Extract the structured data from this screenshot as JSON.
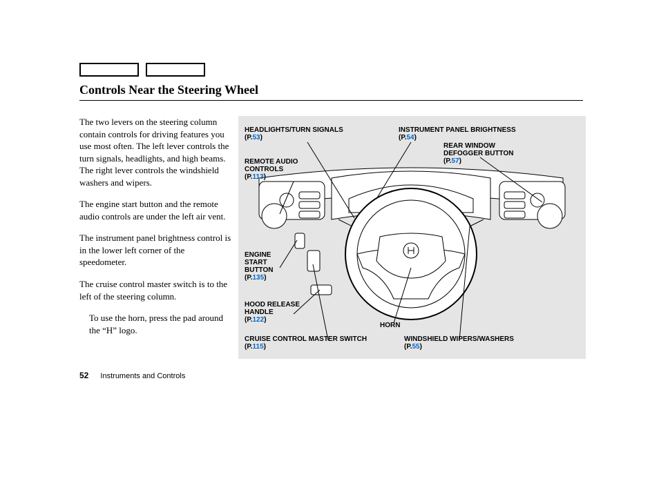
{
  "header": {
    "title": "Controls Near the Steering Wheel"
  },
  "paragraphs": {
    "p1": "The two levers on the steering column contain controls for driving features you use most often. The left lever controls the turn signals, headlights, and high beams. The right lever controls the windshield washers and wipers.",
    "p2": "The engine start button and the remote audio controls are under the left air vent.",
    "p3": "The instrument panel brightness control is in the lower left corner of the speedometer.",
    "p4": "The cruise control master switch is to the left of the steering column.",
    "note": "To use the horn, press the pad around the “H” logo."
  },
  "callouts": {
    "headlights": {
      "label": "HEADLIGHTS/TURN SIGNALS",
      "ref_prefix": "(P.",
      "page": "53",
      "ref_suffix": ")"
    },
    "instrument_brightness": {
      "label": "INSTRUMENT PANEL BRIGHTNESS",
      "ref_prefix": "(P.",
      "page": "54",
      "ref_suffix": ")"
    },
    "remote_audio": {
      "label": "REMOTE AUDIO CONTROLS",
      "ref_prefix": "(P.",
      "page": "113",
      "ref_suffix": ")"
    },
    "defogger": {
      "label": "REAR WINDOW DEFOGGER BUTTON",
      "ref_prefix": "(P.",
      "page": "57",
      "ref_suffix": ")"
    },
    "engine_start": {
      "label": "ENGINE START BUTTON",
      "ref_prefix": "(P.",
      "page": "135",
      "ref_suffix": ")"
    },
    "hood_release": {
      "label": "HOOD RELEASE HANDLE",
      "ref_prefix": "(P.",
      "page": "122",
      "ref_suffix": ")"
    },
    "horn": {
      "label": "HORN"
    },
    "cruise_control": {
      "label": "CRUISE CONTROL MASTER SWITCH",
      "ref_prefix": "(P.",
      "page": "115",
      "ref_suffix": ")"
    },
    "wipers": {
      "label": "WINDSHIELD WIPERS/WASHERS",
      "ref_prefix": "(P.",
      "page": "55",
      "ref_suffix": ")"
    }
  },
  "footer": {
    "page_number": "52",
    "chapter": "Instruments and Controls"
  }
}
